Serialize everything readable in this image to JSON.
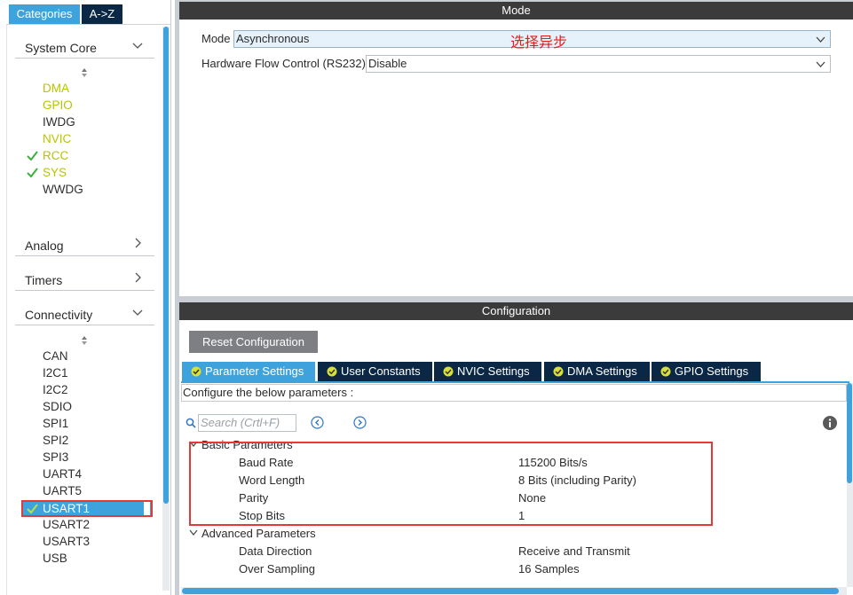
{
  "left_panel": {
    "tabs": {
      "categories": "Categories",
      "az": "A->Z"
    },
    "categories": {
      "system_core": {
        "label": "System Core",
        "items": [
          "DMA",
          "GPIO",
          "IWDG",
          "NVIC",
          "RCC",
          "SYS",
          "WWDG"
        ]
      },
      "analog": {
        "label": "Analog"
      },
      "timers": {
        "label": "Timers"
      },
      "connectivity": {
        "label": "Connectivity",
        "items": [
          "CAN",
          "I2C1",
          "I2C2",
          "SDIO",
          "SPI1",
          "SPI2",
          "SPI3",
          "UART4",
          "UART5",
          "USART1",
          "USART2",
          "USART3",
          "USB"
        ]
      }
    },
    "colors": {
      "accent": "#3ea3dc",
      "yellow_status": "#b8c400",
      "check": "#3db03d",
      "dark_tab": "#0b2746"
    }
  },
  "mode": {
    "title": "Mode",
    "mode_label": "Mode",
    "mode_value": "Asynchronous",
    "annotation": "选择异步",
    "flow_label": "Hardware Flow Control (RS232)",
    "flow_value": "Disable"
  },
  "configuration": {
    "title": "Configuration",
    "reset_button": "Reset Configuration",
    "tabs": [
      "Parameter Settings",
      "User Constants",
      "NVIC Settings",
      "DMA Settings",
      "GPIO Settings"
    ],
    "configure_text": "Configure the below parameters :",
    "search_placeholder": "Search (Crtl+F)",
    "groups": {
      "basic": {
        "label": "Basic Parameters",
        "params": [
          {
            "name": "Baud Rate",
            "value": "115200 Bits/s"
          },
          {
            "name": "Word Length",
            "value": "8 Bits (including Parity)"
          },
          {
            "name": "Parity",
            "value": "None"
          },
          {
            "name": "Stop Bits",
            "value": "1"
          }
        ]
      },
      "advanced": {
        "label": "Advanced Parameters",
        "params": [
          {
            "name": "Data Direction",
            "value": "Receive and Transmit"
          },
          {
            "name": "Over Sampling",
            "value": "16 Samples"
          }
        ]
      }
    },
    "colors": {
      "highlight": "#e23a3a",
      "title_bar": "#3b3b3b"
    }
  }
}
